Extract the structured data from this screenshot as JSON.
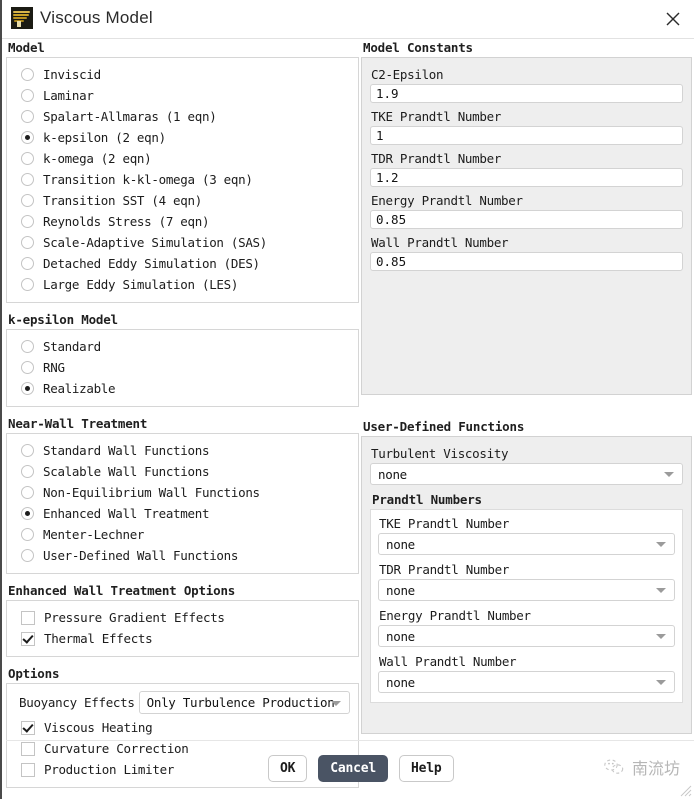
{
  "window": {
    "title": "Viscous Model",
    "icon": "fluent-app-icon",
    "close_icon": "close-icon"
  },
  "model": {
    "title": "Model",
    "options": [
      {
        "label": "Inviscid",
        "selected": false
      },
      {
        "label": "Laminar",
        "selected": false
      },
      {
        "label": "Spalart-Allmaras (1 eqn)",
        "selected": false
      },
      {
        "label": "k-epsilon (2 eqn)",
        "selected": true
      },
      {
        "label": "k-omega (2 eqn)",
        "selected": false
      },
      {
        "label": "Transition k-kl-omega (3 eqn)",
        "selected": false
      },
      {
        "label": "Transition SST (4 eqn)",
        "selected": false
      },
      {
        "label": "Reynolds Stress (7 eqn)",
        "selected": false
      },
      {
        "label": "Scale-Adaptive Simulation (SAS)",
        "selected": false
      },
      {
        "label": "Detached Eddy Simulation (DES)",
        "selected": false
      },
      {
        "label": "Large Eddy Simulation (LES)",
        "selected": false
      }
    ]
  },
  "k_epsilon_model": {
    "title": "k-epsilon Model",
    "options": [
      {
        "label": "Standard",
        "selected": false
      },
      {
        "label": "RNG",
        "selected": false
      },
      {
        "label": "Realizable",
        "selected": true
      }
    ]
  },
  "near_wall_treatment": {
    "title": "Near-Wall Treatment",
    "options": [
      {
        "label": "Standard Wall Functions",
        "selected": false
      },
      {
        "label": "Scalable Wall Functions",
        "selected": false
      },
      {
        "label": "Non-Equilibrium Wall Functions",
        "selected": false
      },
      {
        "label": "Enhanced Wall Treatment",
        "selected": true
      },
      {
        "label": "Menter-Lechner",
        "selected": false
      },
      {
        "label": "User-Defined Wall Functions",
        "selected": false
      }
    ]
  },
  "enhanced_wall_treatment_options": {
    "title": "Enhanced Wall Treatment Options",
    "options": [
      {
        "label": "Pressure Gradient Effects",
        "checked": false
      },
      {
        "label": "Thermal Effects",
        "checked": true
      }
    ]
  },
  "options": {
    "title": "Options",
    "buoyancy_effects": {
      "label": "Buoyancy Effects",
      "value": "Only Turbulence Production"
    },
    "checkboxes": [
      {
        "label": "Viscous Heating",
        "checked": true
      },
      {
        "label": "Curvature Correction",
        "checked": false
      },
      {
        "label": "Production Limiter",
        "checked": false
      }
    ]
  },
  "model_constants": {
    "title": "Model Constants",
    "fields": [
      {
        "label": "C2-Epsilon",
        "value": "1.9"
      },
      {
        "label": "TKE Prandtl Number",
        "value": "1"
      },
      {
        "label": "TDR Prandtl Number",
        "value": "1.2"
      },
      {
        "label": "Energy Prandtl Number",
        "value": "0.85"
      },
      {
        "label": "Wall Prandtl Number",
        "value": "0.85"
      }
    ]
  },
  "user_defined_functions": {
    "title": "User-Defined Functions",
    "turbulent_viscosity": {
      "label": "Turbulent Viscosity",
      "value": "none"
    },
    "prandtl_numbers": {
      "title": "Prandtl Numbers",
      "fields": [
        {
          "label": "TKE Prandtl Number",
          "value": "none"
        },
        {
          "label": "TDR Prandtl Number",
          "value": "none"
        },
        {
          "label": "Energy Prandtl Number",
          "value": "none"
        },
        {
          "label": "Wall Prandtl Number",
          "value": "none"
        }
      ]
    }
  },
  "footer": {
    "buttons": [
      {
        "label": "OK",
        "primary": false
      },
      {
        "label": "Cancel",
        "primary": true
      },
      {
        "label": "Help",
        "primary": false
      }
    ],
    "watermark": {
      "text": "南流坊",
      "icon": "wechat-icon"
    }
  },
  "colors": {
    "primary_button": "#4a5464",
    "panel_fill": "#eeeeee",
    "border": "#d6d6d6"
  }
}
